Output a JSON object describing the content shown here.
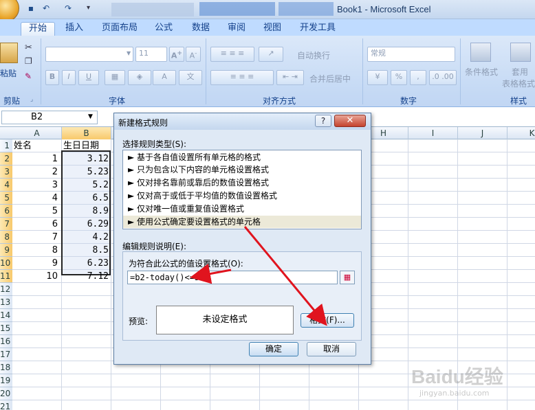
{
  "window": {
    "title": "Book1 - Microsoft Excel"
  },
  "ribbon": {
    "tabs": [
      "开始",
      "插入",
      "页面布局",
      "公式",
      "数据",
      "审阅",
      "视图",
      "开发工具"
    ],
    "clipboard": {
      "paste": "粘贴",
      "group": "剪贴板"
    },
    "font": {
      "size": "11",
      "group": "字体"
    },
    "alignment": {
      "wrap": "自动换行",
      "merge": "合并后居中",
      "group": "对齐方式"
    },
    "number": {
      "format": "常规",
      "group": "数字"
    },
    "styles": {
      "conditional": "条件格式",
      "table": "套用",
      "table2": "表格格式",
      "group": "样式"
    }
  },
  "namebox": {
    "value": "B2"
  },
  "sheet": {
    "columns": [
      "A",
      "B",
      "C",
      "D",
      "E",
      "F",
      "G",
      "H",
      "I",
      "J",
      "K"
    ],
    "rows": [
      "1",
      "2",
      "3",
      "4",
      "5",
      "6",
      "7",
      "8",
      "9",
      "10",
      "11",
      "12",
      "13",
      "14",
      "15",
      "16",
      "17",
      "18",
      "19",
      "20",
      "21"
    ],
    "header_a": "姓名",
    "header_b": "生日日期",
    "col_a": [
      "1",
      "2",
      "3",
      "4",
      "5",
      "6",
      "7",
      "8",
      "9",
      "10"
    ],
    "col_b": [
      "3.12",
      "5.23",
      "5.2",
      "6.5",
      "8.9",
      "6.29",
      "4.2",
      "8.5",
      "6.23",
      "7.12"
    ]
  },
  "dialog": {
    "title": "新建格式规则",
    "help": "?",
    "close": "✕",
    "select_label": "选择规则类型(S):",
    "rules": [
      "► 基于各自值设置所有单元格的格式",
      "► 只为包含以下内容的单元格设置格式",
      "► 仅对排名靠前或靠后的数值设置格式",
      "► 仅对高于或低于平均值的数值设置格式",
      "► 仅对唯一值或重复值设置格式",
      "► 使用公式确定要设置格式的单元格"
    ],
    "edit_label": "编辑规则说明(E):",
    "formula_label": "为符合此公式的值设置格式(O):",
    "formula_value": "=b2-today()<=5",
    "preview_label": "预览:",
    "preview_text": "未设定格式",
    "format_button": "格式(F)...",
    "ok": "确定",
    "cancel": "取消"
  },
  "watermark": {
    "text": "Baidu经验",
    "sub": "jingyan.baidu.com"
  }
}
